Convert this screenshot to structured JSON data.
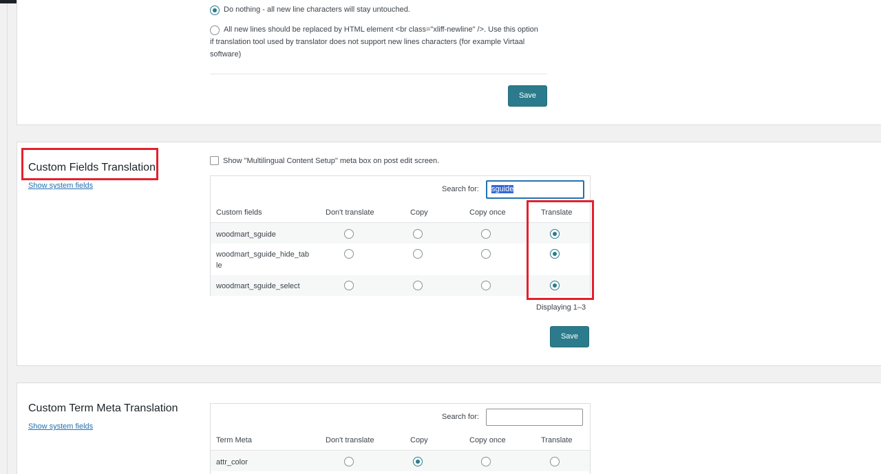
{
  "newline_section": {
    "option_do_nothing": "Do nothing - all new line characters will stay untouched.",
    "option_replace_line1": "All new lines should be replaced by HTML element <br class=\"xliff-newline\" />. Use this option",
    "option_replace_line2": "if translation tool used by translator does not support new lines characters (for example Virtaal",
    "option_replace_line3": "software)",
    "save_label": "Save"
  },
  "custom_fields": {
    "title": "Custom Fields Translation",
    "show_system_fields": "Show system fields",
    "metabox_checkbox_label": "Show \"Multilingual Content Setup\" meta box on post edit screen.",
    "search_label": "Search for:",
    "search_value": "sguide",
    "columns": [
      "Custom fields",
      "Don't translate",
      "Copy",
      "Copy once",
      "Translate"
    ],
    "rows": [
      {
        "name": "woodmart_sguide",
        "name_line2": "",
        "selected": "Translate"
      },
      {
        "name": "woodmart_sguide_hide_tab",
        "name_line2": "le",
        "selected": "Translate"
      },
      {
        "name": "woodmart_sguide_select",
        "name_line2": "",
        "selected": "Translate"
      }
    ],
    "displaying": "Displaying 1–3",
    "save_label": "Save"
  },
  "term_meta": {
    "title": "Custom Term Meta Translation",
    "show_system_fields": "Show system fields",
    "search_label": "Search for:",
    "search_value": "",
    "columns": [
      "Term Meta",
      "Don't translate",
      "Copy",
      "Copy once",
      "Translate"
    ],
    "rows": [
      {
        "name": "attr_color",
        "selected": "Copy"
      }
    ]
  },
  "colors": {
    "accent": "#2c7b8c",
    "highlight_box": "#e3202c",
    "link": "#2271b1"
  }
}
